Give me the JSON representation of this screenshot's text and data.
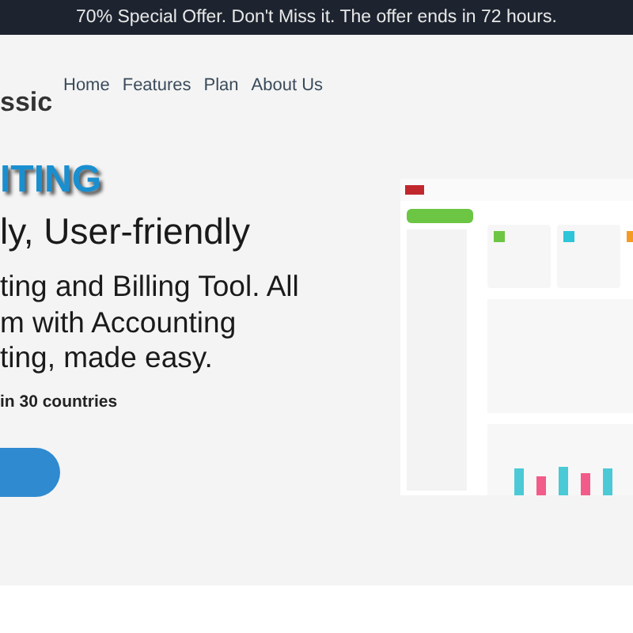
{
  "offer_bar": {
    "text": "70% Special Offer. Don't Miss it. The offer ends in 72 hours."
  },
  "navbar": {
    "logo": "ssic",
    "links": [
      "Home",
      "Features",
      "Plan",
      "About Us"
    ]
  },
  "hero": {
    "eyebrow": "ITING",
    "headline": "ly, User-friendly",
    "description": [
      "ting and Billing Tool. All",
      "m with Accounting",
      "ting, made easy."
    ],
    "trust_note": "in 30 countries"
  }
}
